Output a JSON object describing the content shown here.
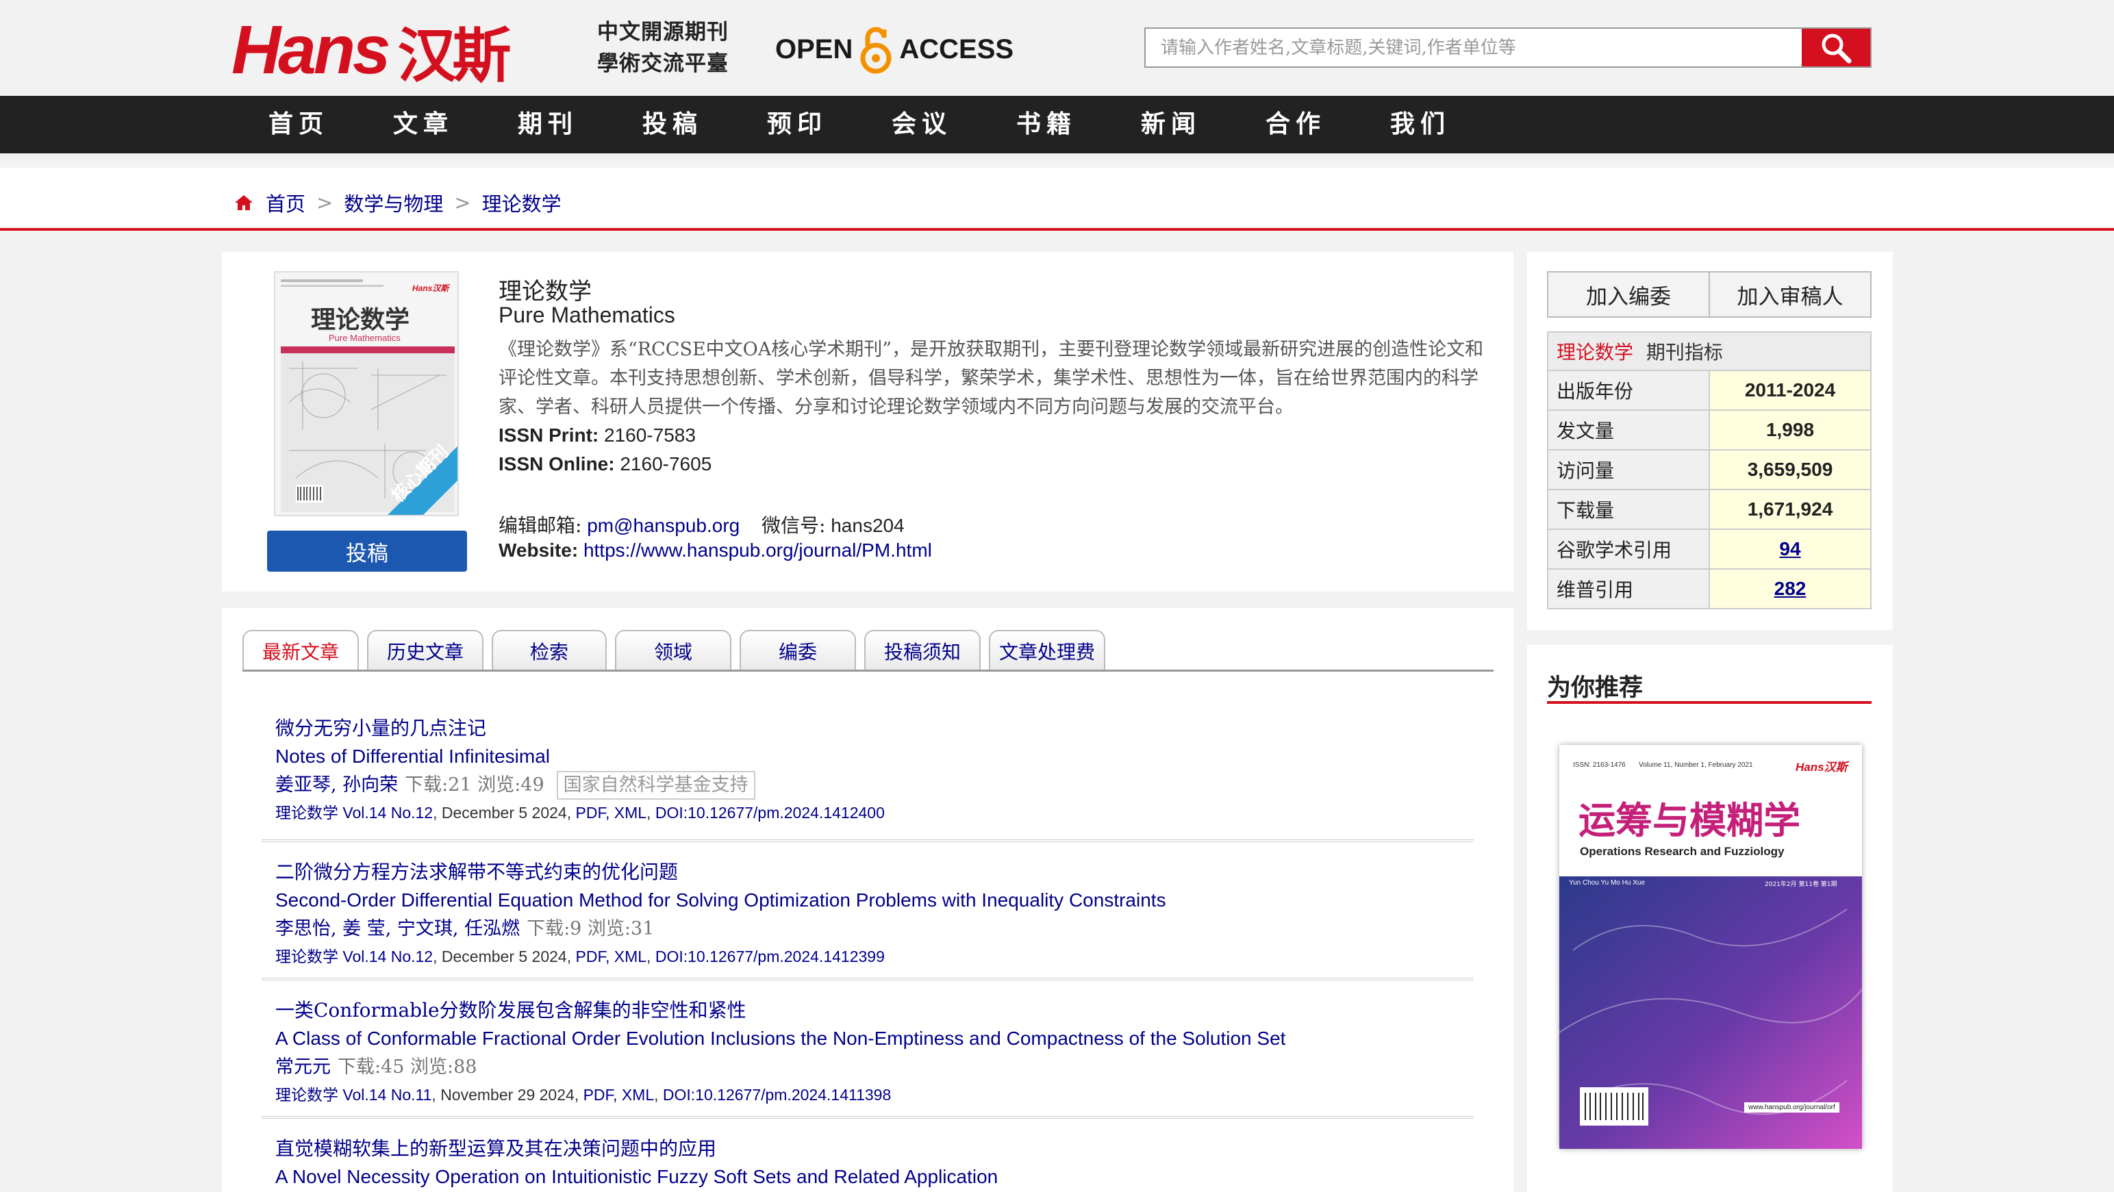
{
  "header": {
    "logo_text": "Hans",
    "logo_cn": "汉斯",
    "tagline_line1": "中文開源期刊",
    "tagline_line2": "學術交流平臺",
    "open_access": [
      "OPEN",
      "ACCESS"
    ],
    "search_placeholder": "请输入作者姓名,文章标题,关键词,作者单位等",
    "brand_color": "#d4101f"
  },
  "nav": [
    "首页",
    "文章",
    "期刊",
    "投稿",
    "预印",
    "会议",
    "书籍",
    "新闻",
    "合作",
    "我们"
  ],
  "breadcrumb": [
    "首页",
    "数学与物理",
    "理论数学"
  ],
  "journal": {
    "title_cn": "理论数学",
    "title_en": "Pure Mathematics",
    "description": "《理论数学》系“RCCSE中文OA核心学术期刊”，是开放获取期刊，主要刊登理论数学领域最新研究进展的创造性论文和评论性文章。本刊支持思想创新、学术创新，倡导科学，繁荣学术，集学术性、思想性为一体，旨在给世界范围内的科学家、学者、科研人员提供一个传播、分享和讨论理论数学领域内不同方向问题与发展的交流平台。",
    "issn_print_label": "ISSN Print:",
    "issn_print": "2160-7583",
    "issn_online_label": "ISSN Online:",
    "issn_online": "2160-7605",
    "email_label": "编辑邮箱:",
    "email": "pm@hanspub.org",
    "wechat_label": "微信号:",
    "wechat": "hans204",
    "website_label": "Website:",
    "website": "https://www.hanspub.org/journal/PM.html",
    "submit_label": "投稿",
    "cover": {
      "title": "理论数学",
      "subtitle": "Pure Mathematics",
      "badge": "核心期刊",
      "brand": "Hans汉斯"
    }
  },
  "tabs": [
    "最新文章",
    "历史文章",
    "检索",
    "领域",
    "编委",
    "投稿须知",
    "文章处理费"
  ],
  "articles": [
    {
      "title_cn": "微分无穷小量的几点注记",
      "title_en": "Notes of Differential Infinitesimal",
      "authors": "姜亚琴, 孙向荣",
      "stats": "下载:21  浏览:49",
      "fund": "国家自然科学基金支持",
      "journal": "理论数学",
      "issue": "Vol.14 No.12",
      "date": "December 5 2024",
      "formats": "PDF, XML",
      "doi": "DOI:10.12677/pm.2024.1412400"
    },
    {
      "title_cn": "二阶微分方程方法求解带不等式约束的优化问题",
      "title_en": "Second-Order Differential Equation Method for Solving Optimization Problems with Inequality Constraints",
      "authors": "李思怡, 姜 莹, 宁文琪, 任泓燃",
      "stats": "下载:9  浏览:31",
      "fund": "",
      "journal": "理论数学",
      "issue": "Vol.14 No.12",
      "date": "December 5 2024",
      "formats": "PDF, XML",
      "doi": "DOI:10.12677/pm.2024.1412399"
    },
    {
      "title_cn": "一类Conformable分数阶发展包含解集的非空性和紧性",
      "title_en": "A Class of Conformable Fractional Order Evolution Inclusions the Non-Emptiness and Compactness of the Solution Set",
      "authors": "常元元",
      "stats": "下载:45  浏览:88",
      "fund": "",
      "journal": "理论数学",
      "issue": "Vol.14 No.11",
      "date": "November 29 2024",
      "formats": "PDF, XML",
      "doi": "DOI:10.12677/pm.2024.1411398"
    },
    {
      "title_cn": "直觉模糊软集上的新型运算及其在决策问题中的应用",
      "title_en": "A Novel Necessity Operation on Intuitionistic Fuzzy Soft Sets and Related Application"
    }
  ],
  "sidebar": {
    "join_editorial": "加入编委",
    "join_reviewer": "加入审稿人",
    "metrics_journal": "理论数学",
    "metrics_title": "期刊指标",
    "metrics": [
      {
        "label": "出版年份",
        "value": "2011-2024",
        "link": false
      },
      {
        "label": "发文量",
        "value": "1,998",
        "link": false
      },
      {
        "label": "访问量",
        "value": "3,659,509",
        "link": false
      },
      {
        "label": "下载量",
        "value": "1,671,924",
        "link": false
      },
      {
        "label": "谷歌学术引用",
        "value": "94",
        "link": true
      },
      {
        "label": "维普引用",
        "value": "282",
        "link": true
      }
    ],
    "recommend_title": "为你推荐",
    "rec_cover": {
      "issn": "ISSN: 2163-1476",
      "volume": "Volume 11, Number 1, February 2021",
      "brand": "Hans汉斯",
      "title_cn": "运筹与模糊学",
      "title_en": "Operations Research and Fuzziology",
      "pinyin": "Yun Chou Yu Mo Hu Xue",
      "date": "2021年2月 第11卷 第1期",
      "url": "www.hanspub.org/journal/orf"
    }
  }
}
